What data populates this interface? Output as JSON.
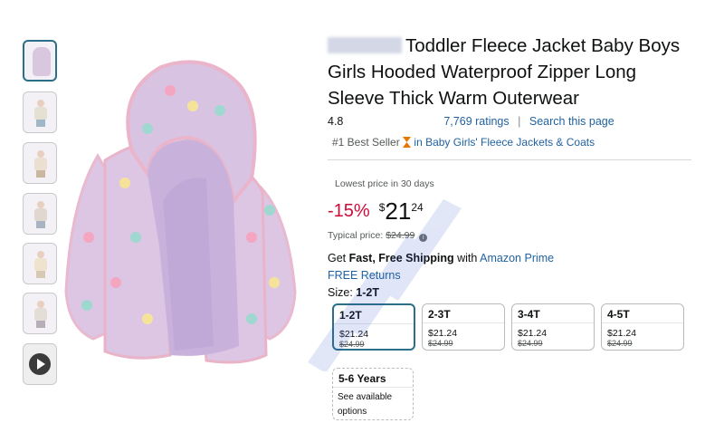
{
  "product": {
    "title": "Toddler Fleece Jacket Baby Boys Girls Hooded Waterproof Zipper Long Sleeve Thick Warm Outerwear",
    "rating_value": "4.8",
    "ratings_count": "7,769 ratings",
    "separator": "|",
    "search_link": "Search this page",
    "best_seller_badge": "#1 Best Seller",
    "best_seller_category": "in Baby Girls' Fleece Jackets & Coats"
  },
  "price": {
    "lowest_label": "Lowest price in 30 days",
    "discount": "-15%",
    "currency": "$",
    "whole": "21",
    "fraction": "24",
    "typical_label": "Typical price:",
    "typical_value": "$24.99"
  },
  "shipping": {
    "get": "Get",
    "fast": "Fast, Free Shipping",
    "with": "with",
    "prime_link": "Amazon Prime",
    "returns_link": "FREE Returns"
  },
  "size": {
    "label": "Size:",
    "selected": "1-2T",
    "options": [
      {
        "name": "1-2T",
        "price": "$21.24",
        "old": "$24.99"
      },
      {
        "name": "2-3T",
        "price": "$21.24",
        "old": "$24.99"
      },
      {
        "name": "3-4T",
        "price": "$21.24",
        "old": "$24.99"
      },
      {
        "name": "4-5T",
        "price": "$21.24",
        "old": "$24.99"
      },
      {
        "name": "5-6 Years",
        "availability": "See available options"
      }
    ]
  },
  "colors": {
    "link": "#2162a1",
    "discount": "#cc0c39",
    "selected_border": "#2b6f8a"
  },
  "icons": [
    "play-icon",
    "hourglass-icon",
    "info-icon"
  ]
}
